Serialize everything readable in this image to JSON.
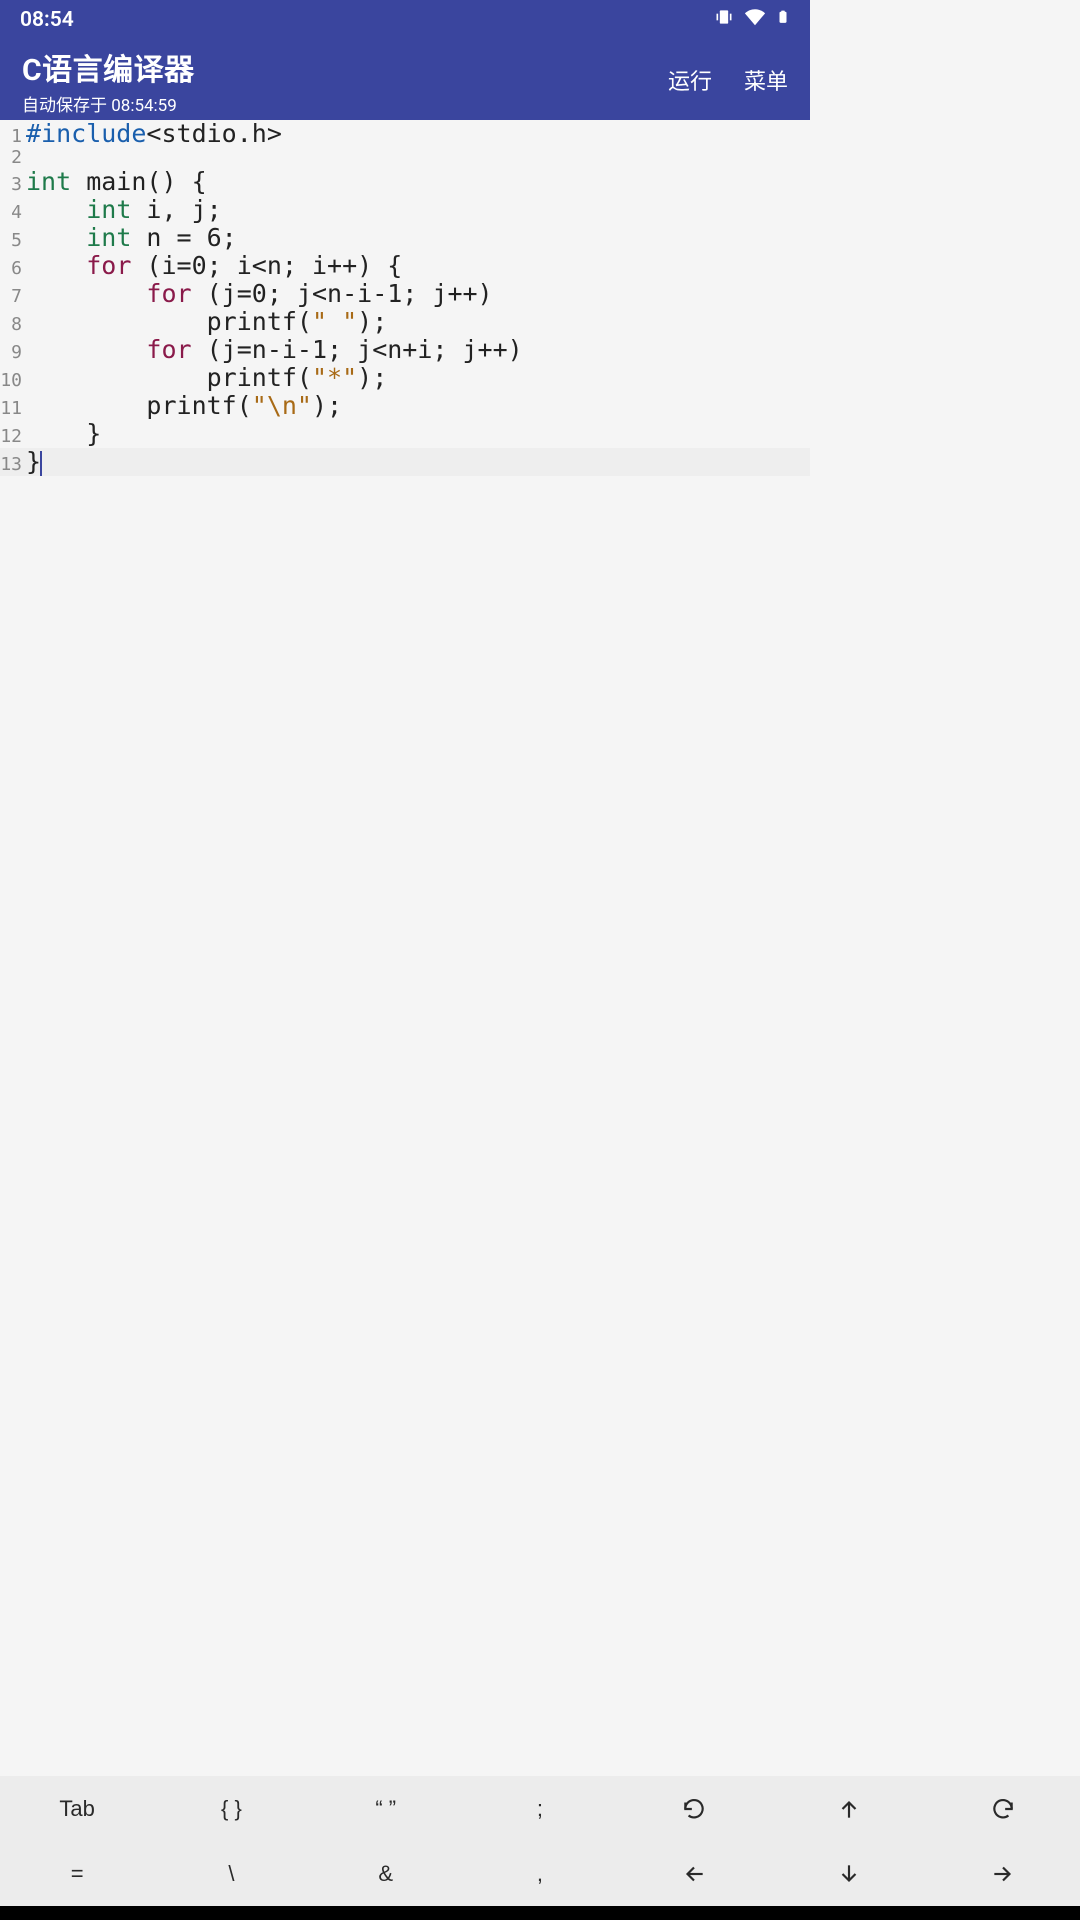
{
  "status": {
    "time": "08:54"
  },
  "header": {
    "title": "C语言编译器",
    "subtitle": "自动保存于 08:54:59",
    "run_label": "运行",
    "menu_label": "菜单"
  },
  "code": {
    "lines": [
      {
        "n": "1",
        "tokens": [
          [
            "kw-pre",
            "#include"
          ],
          [
            "",
            "<stdio.h>"
          ]
        ]
      },
      {
        "n": "2",
        "tokens": []
      },
      {
        "n": "3",
        "tokens": [
          [
            "kw-type",
            "int"
          ],
          [
            "",
            " main() {"
          ]
        ]
      },
      {
        "n": "4",
        "tokens": [
          [
            "",
            "    "
          ],
          [
            "kw-type",
            "int"
          ],
          [
            "",
            " i, j;"
          ]
        ]
      },
      {
        "n": "5",
        "tokens": [
          [
            "",
            "    "
          ],
          [
            "kw-type",
            "int"
          ],
          [
            "",
            " n = 6;"
          ]
        ]
      },
      {
        "n": "6",
        "tokens": [
          [
            "",
            "    "
          ],
          [
            "kw-ctrl",
            "for"
          ],
          [
            "",
            " (i=0; i<n; i++) {"
          ]
        ]
      },
      {
        "n": "7",
        "tokens": [
          [
            "",
            "        "
          ],
          [
            "kw-ctrl",
            "for"
          ],
          [
            "",
            " (j=0; j<n-i-1; j++)"
          ]
        ]
      },
      {
        "n": "8",
        "tokens": [
          [
            "",
            "            printf("
          ],
          [
            "str",
            "\" \""
          ],
          [
            "",
            ");"
          ]
        ]
      },
      {
        "n": "9",
        "tokens": [
          [
            "",
            "        "
          ],
          [
            "kw-ctrl",
            "for"
          ],
          [
            "",
            " (j=n-i-1; j<n+i; j++)"
          ]
        ]
      },
      {
        "n": "10",
        "tokens": [
          [
            "",
            "            printf("
          ],
          [
            "str",
            "\"*\""
          ],
          [
            "",
            ");"
          ]
        ]
      },
      {
        "n": "11",
        "tokens": [
          [
            "",
            "        printf("
          ],
          [
            "str",
            "\"\\n\""
          ],
          [
            "",
            ");"
          ]
        ]
      },
      {
        "n": "12",
        "tokens": [
          [
            "",
            "    }"
          ]
        ]
      },
      {
        "n": "13",
        "tokens": [
          [
            "",
            "}"
          ]
        ],
        "current": true,
        "cursor": true
      }
    ]
  },
  "toolbar": {
    "row1": [
      "Tab",
      "{ }",
      "“ ”",
      ";",
      "undo-icon",
      "up-arrow-icon",
      "redo-icon"
    ],
    "row2": [
      "=",
      "\\",
      "&",
      ",",
      "left-arrow-icon",
      "down-arrow-icon",
      "right-arrow-icon"
    ]
  }
}
